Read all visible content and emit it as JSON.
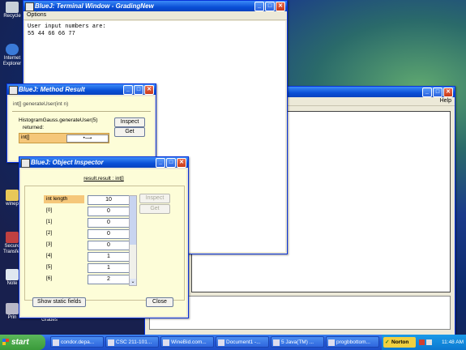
{
  "desktop": {
    "icons": [
      "Recycle",
      "Internet Explorer",
      "winep",
      "Secure Transfer",
      "Note",
      "Prin",
      "Grades"
    ]
  },
  "terminal": {
    "title": "BlueJ: Terminal Window - GradingNew",
    "menu": "Options",
    "line1": "User input numbers are:",
    "line2": "55 44 66 66 77"
  },
  "background_window": {
    "menu": "Help"
  },
  "method_result": {
    "title": "BlueJ: Method Result",
    "signature": "int[] generateUser(int n)",
    "call": "HistogramGauss.generateUser(5)",
    "returned_label": "returned:",
    "result_type": "int[]",
    "inspect_label": "Inspect",
    "get_label": "Get"
  },
  "object_inspector": {
    "title": "BlueJ: Object Inspector",
    "heading": "result.result : int[]",
    "rows": [
      {
        "label": "int length",
        "value": "10"
      },
      {
        "label": "[0]",
        "value": "0"
      },
      {
        "label": "[1]",
        "value": "0"
      },
      {
        "label": "[2]",
        "value": "0"
      },
      {
        "label": "[3]",
        "value": "0"
      },
      {
        "label": "[4]",
        "value": "1"
      },
      {
        "label": "[5]",
        "value": "1"
      },
      {
        "label": "[6]",
        "value": "2"
      }
    ],
    "inspect_label": "Inspect",
    "get_label": "Get",
    "static_fields_label": "Show static fields",
    "close_label": "Close"
  },
  "taskbar": {
    "start_label": "start",
    "items": [
      {
        "label": "condor.depa..."
      },
      {
        "label": "CSC 211-101..."
      },
      {
        "label": "WineBid.com..."
      },
      {
        "label": "Document1 -..."
      },
      {
        "label": "5 Java(TM) ..."
      },
      {
        "label": "progbbottom..."
      }
    ],
    "norton_label": "Norton",
    "clock": "11:48 AM"
  },
  "colors": {
    "title_bar": "#0a4fd6",
    "bluej_yellow": "#fdfdd8",
    "selected_row": "#f5c77a",
    "taskbar": "#2458d8",
    "start_button": "#3a9a3a"
  }
}
